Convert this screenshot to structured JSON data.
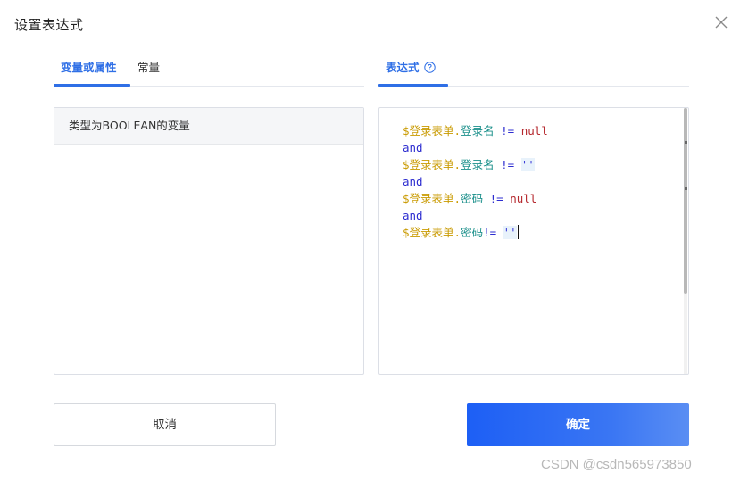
{
  "dialog": {
    "title": "设置表达式"
  },
  "left_tabs": [
    {
      "label": "变量或属性",
      "active": true
    },
    {
      "label": "常量",
      "active": false
    }
  ],
  "right_tabs": [
    {
      "label": "表达式",
      "active": true,
      "icon": "help-circle-icon"
    }
  ],
  "left_panel": {
    "header": "类型为BOOLEAN的变量",
    "items": []
  },
  "editor": {
    "lines": [
      [
        {
          "t": "var",
          "v": "$登录表单"
        },
        {
          "t": "var",
          "v": "."
        },
        {
          "t": "field",
          "v": "登录名"
        },
        {
          "t": "op",
          "v": " != "
        },
        {
          "t": "null",
          "v": "null"
        }
      ],
      [
        {
          "t": "kw",
          "v": "and"
        }
      ],
      [
        {
          "t": "var",
          "v": "$登录表单"
        },
        {
          "t": "var",
          "v": "."
        },
        {
          "t": "field",
          "v": "登录名"
        },
        {
          "t": "op",
          "v": " != "
        },
        {
          "t": "str",
          "v": "''"
        }
      ],
      [
        {
          "t": "kw",
          "v": "and"
        }
      ],
      [
        {
          "t": "var",
          "v": "$登录表单"
        },
        {
          "t": "var",
          "v": "."
        },
        {
          "t": "field",
          "v": "密码"
        },
        {
          "t": "op",
          "v": " != "
        },
        {
          "t": "null",
          "v": "null"
        }
      ],
      [
        {
          "t": "kw",
          "v": "and"
        }
      ],
      [
        {
          "t": "var",
          "v": "$登录表单"
        },
        {
          "t": "var",
          "v": "."
        },
        {
          "t": "field",
          "v": "密码"
        },
        {
          "t": "op",
          "v": "!= "
        },
        {
          "t": "str",
          "v": "''"
        }
      ]
    ],
    "cursor_line": 6
  },
  "buttons": {
    "cancel": "取消",
    "ok": "确定"
  },
  "watermark": "CSDN @csdn565973850",
  "colors": {
    "accent": "#2f6fe6",
    "primary_button": "#1d5ff5",
    "variable": "#c99a00",
    "field": "#1a8f8a",
    "operator": "#2d2dd0",
    "null": "#b5282e"
  }
}
